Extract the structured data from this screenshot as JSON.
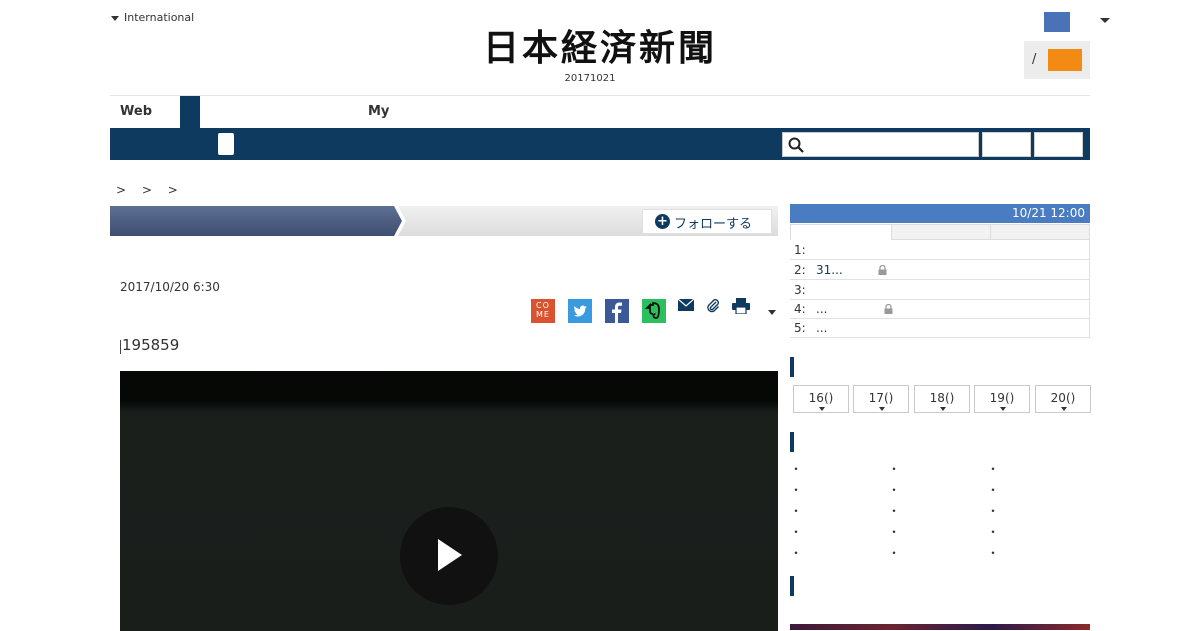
{
  "header": {
    "international_label": "International",
    "logo_text": "日本経済新聞",
    "edition_date": "20171021",
    "login_separator": "/"
  },
  "tabs": [
    {
      "label": "Web"
    },
    {
      "label": "My"
    }
  ],
  "search": {
    "placeholder": ""
  },
  "breadcrumb": ">  >  >",
  "follow_button": {
    "label": "フォローする",
    "icon": "plus-circle-icon"
  },
  "article": {
    "datetime": "2017/10/20 6:30",
    "code": "195859",
    "share_icons": [
      "come-icon",
      "twitter-icon",
      "facebook-icon",
      "evernote-icon",
      "mail-icon",
      "clip-icon",
      "print-icon",
      "more-caret-icon"
    ],
    "come_label": "COME"
  },
  "video": {
    "play_icon": "play-icon"
  },
  "ranking": {
    "updated": "10/21 12:00",
    "rows": [
      {
        "num": "1:",
        "text": ""
      },
      {
        "num": "2:",
        "text": "31...",
        "locked": true
      },
      {
        "num": "3:",
        "text": ""
      },
      {
        "num": "4:",
        "text": "...",
        "locked": true
      },
      {
        "num": "5:",
        "text": "..."
      }
    ]
  },
  "date_buttons": [
    "16()",
    "17()",
    "18()",
    "19()",
    "20()"
  ],
  "bullet": "・",
  "colors": {
    "navy": "#0f3a5f",
    "ranking_blue": "#4a7cc1",
    "orange": "#f28a13",
    "flag_blue": "#4a72b6"
  }
}
